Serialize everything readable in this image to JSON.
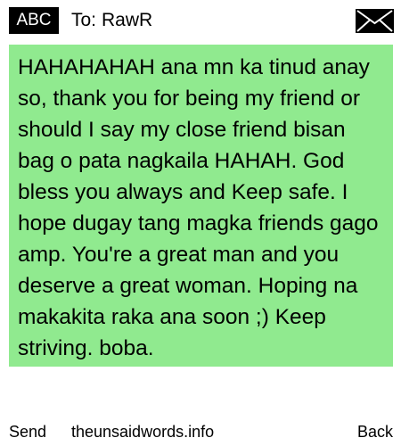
{
  "header": {
    "mode": "ABC",
    "to_label": "To:",
    "recipient": "RawR",
    "icon": "envelope-icon"
  },
  "message": {
    "text": "HAHAHAHAH ana mn ka tinud anay so, thank you for being my friend or should I say my close friend bisan bag o pata nagkaila HAHAH. God bless you always and Keep safe. I hope dugay tang magka friends gago amp. You're a great man and you deserve a great woman. Hoping na makakita raka ana soon ;)  Keep striving. boba."
  },
  "softkeys": {
    "left": "Send",
    "center": "theunsaidwords.info",
    "right": "Back"
  },
  "colors": {
    "message_background": "#90ea8f",
    "badge_background": "#000000",
    "badge_text": "#ffffff"
  }
}
